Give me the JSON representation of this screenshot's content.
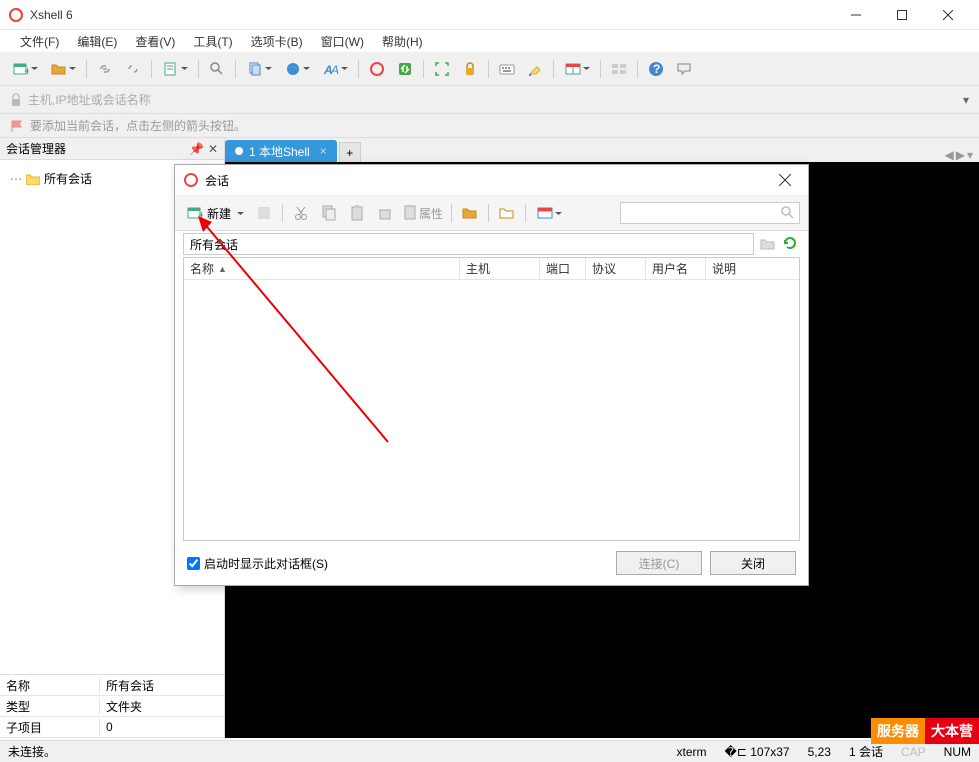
{
  "window": {
    "title": "Xshell 6"
  },
  "menu": {
    "file": "文件(F)",
    "edit": "编辑(E)",
    "view": "查看(V)",
    "tools": "工具(T)",
    "tabs": "选项卡(B)",
    "window": "窗口(W)",
    "help": "帮助(H)"
  },
  "address": {
    "placeholder": "主机,IP地址或会话名称"
  },
  "hint": "要添加当前会话，点击左侧的箭头按钮。",
  "sidebar": {
    "title": "会话管理器",
    "root": "所有会话"
  },
  "props": {
    "name_k": "名称",
    "name_v": "所有会话",
    "type_k": "类型",
    "type_v": "文件夹",
    "sub_k": "子项目",
    "sub_v": "0"
  },
  "tab": {
    "label": "1 本地Shell"
  },
  "dialog": {
    "title": "会话",
    "new": "新建",
    "props_btn": "属性",
    "path": "所有会话",
    "cols": {
      "name": "名称",
      "host": "主机",
      "port": "端口",
      "proto": "协议",
      "user": "用户名",
      "desc": "说明"
    },
    "startup": "启动时显示此对话框(S)",
    "connect": "连接(C)",
    "close": "关闭"
  },
  "status": {
    "left": "未连接。",
    "term": "xterm",
    "size": "107x37",
    "cursor": "5,23",
    "sess": "1 会话",
    "cap": "CAP",
    "num": "NUM"
  },
  "watermark": {
    "a": "服务器",
    "b": "大本营"
  }
}
